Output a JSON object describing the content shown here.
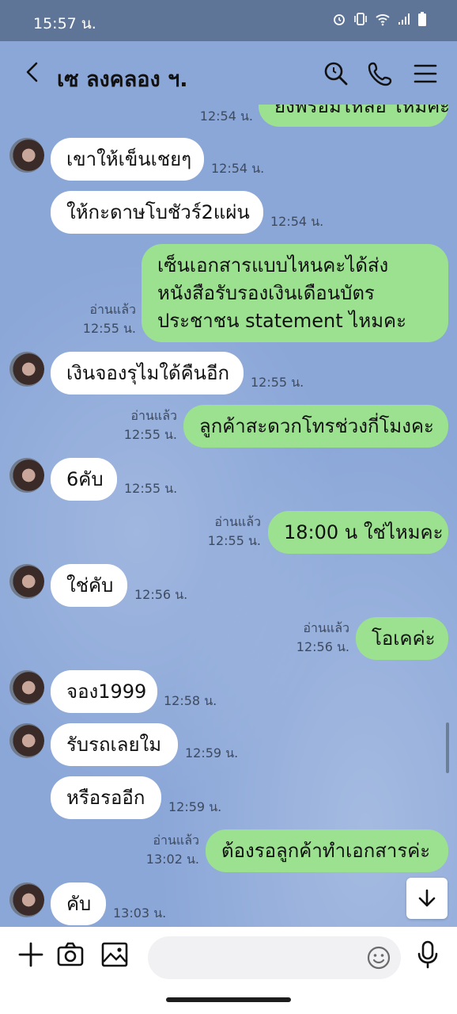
{
  "status_bar": {
    "time": "15:57 น."
  },
  "header": {
    "title": "เซ ลงคลอง ฯ."
  },
  "messages": [
    {
      "id": "m0",
      "dir": "out",
      "text": "ยังพร้อมไหลือ ไหมคะ",
      "time": "12:54 น."
    },
    {
      "id": "m1",
      "dir": "in",
      "text": "เขาให้เข็นเชยๆ",
      "time": "12:54 น."
    },
    {
      "id": "m2",
      "dir": "in",
      "text": "ให้กะดาษโบชัวร์2แผ่น",
      "time": "12:54 น."
    },
    {
      "id": "m3",
      "dir": "out",
      "lines": [
        "เซ็นเอกสารแบบไหนคะได้ส่ง",
        "หนังสือรับรองเงินเดือนบัตร",
        "ประชาชน statement ไหมคะ"
      ],
      "read": "อ่านแล้ว",
      "time": "12:55 น."
    },
    {
      "id": "m4",
      "dir": "in",
      "text": "เงินจองรุไมใด้คืนอีก",
      "time": "12:55 น."
    },
    {
      "id": "m5",
      "dir": "out",
      "text": "ลูกค้าสะดวกโทรช่วงกี่โมงคะ",
      "read": "อ่านแล้ว",
      "time": "12:55 น."
    },
    {
      "id": "m6",
      "dir": "in",
      "text": "6คับ",
      "time": "12:55 น."
    },
    {
      "id": "m7",
      "dir": "out",
      "text": "18:00 น ใช่ไหมคะ",
      "read": "อ่านแล้ว",
      "time": "12:55 น."
    },
    {
      "id": "m8",
      "dir": "in",
      "text": "ใช่คับ",
      "time": "12:56 น."
    },
    {
      "id": "m9",
      "dir": "out",
      "text": "โอเคค่ะ",
      "read": "อ่านแล้ว",
      "time": "12:56 น."
    },
    {
      "id": "m10",
      "dir": "in",
      "text": "จอง1999",
      "time": "12:58 น."
    },
    {
      "id": "m11",
      "dir": "in",
      "text": "รับรถเลยใม",
      "time": "12:59 น."
    },
    {
      "id": "m12",
      "dir": "in",
      "text": "หรือรออีก",
      "time": "12:59 น."
    },
    {
      "id": "m13",
      "dir": "out",
      "text": "ต้องรอลูกค้าทำเอกสารค่ะ",
      "read": "อ่านแล้ว",
      "time": "13:02 น."
    },
    {
      "id": "m14",
      "dir": "in",
      "text": "คับ",
      "time": "13:03 น."
    }
  ],
  "input": {
    "placeholder": ""
  },
  "colors": {
    "chat_bg": "#8ba7d8",
    "outgoing_bubble": "#9be18f",
    "incoming_bubble": "#ffffff",
    "status_bar": "#5f7597"
  },
  "icons": [
    "back-icon",
    "search-icon",
    "phone-icon",
    "menu-icon",
    "plus-icon",
    "camera-icon",
    "image-icon",
    "emoji-icon",
    "mic-icon",
    "scroll-down-icon",
    "alarm-icon",
    "vibrate-icon",
    "wifi-icon",
    "signal-icon",
    "battery-icon"
  ]
}
